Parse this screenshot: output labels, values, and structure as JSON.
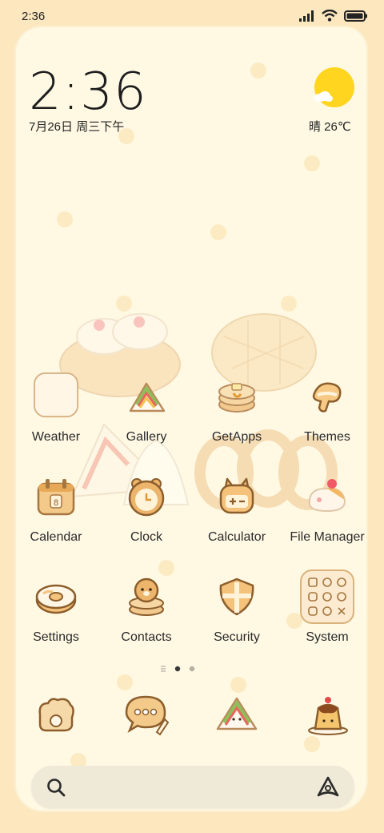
{
  "status_bar": {
    "time": "2:36",
    "icons": [
      "signal-icon",
      "wifi-icon",
      "battery-icon"
    ]
  },
  "widget": {
    "time": "2:36",
    "date": "7月26日 周三下午",
    "weather": "晴 26℃",
    "weather_icon": "sunny-cloud-icon"
  },
  "apps": [
    {
      "label": "Weather",
      "icon": "weather-icon"
    },
    {
      "label": "Gallery",
      "icon": "gallery-icon"
    },
    {
      "label": "GetApps",
      "icon": "getapps-icon"
    },
    {
      "label": "Themes",
      "icon": "themes-icon"
    },
    {
      "label": "Calendar",
      "icon": "calendar-icon"
    },
    {
      "label": "Clock",
      "icon": "clock-icon"
    },
    {
      "label": "Calculator",
      "icon": "calculator-icon"
    },
    {
      "label": "File Manager",
      "icon": "file-manager-icon"
    },
    {
      "label": "Settings",
      "icon": "settings-icon"
    },
    {
      "label": "Contacts",
      "icon": "contacts-icon"
    },
    {
      "label": "Security",
      "icon": "security-icon"
    },
    {
      "label": "System",
      "icon": "system-folder-icon"
    }
  ],
  "pager": {
    "pages": 3,
    "current": 2
  },
  "dock": [
    "camera-icon",
    "messages-icon",
    "browser-icon",
    "pudding-icon"
  ],
  "search_bar": {
    "icons": [
      "search-icon",
      "assistant-icon"
    ]
  },
  "colors": {
    "background": "#FCE7BE",
    "panel": "#FFF9E4",
    "sun": "#FFD51F",
    "accent": "#E8A24A"
  }
}
